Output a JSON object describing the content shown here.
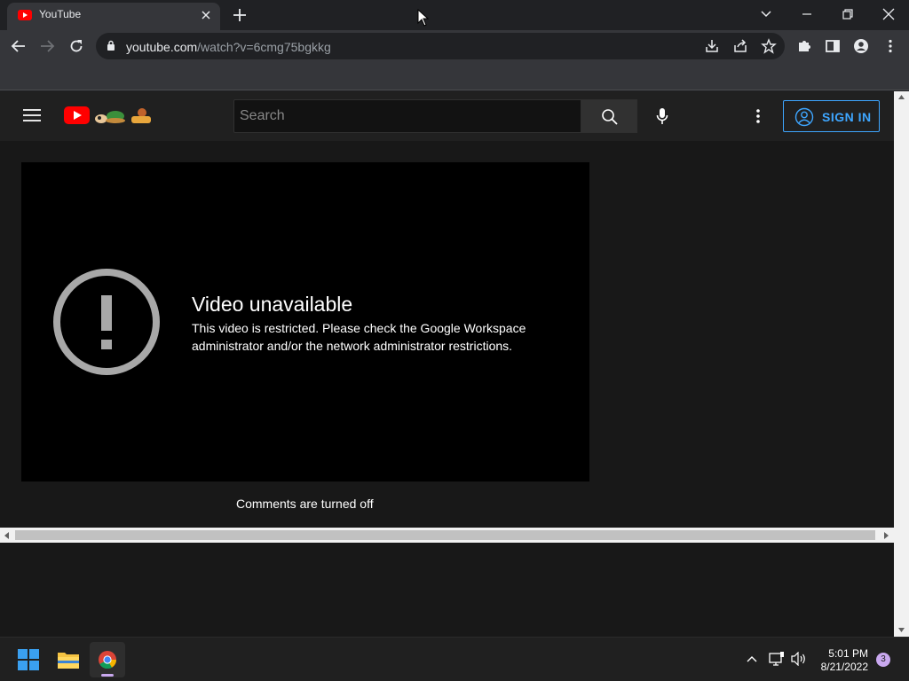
{
  "browser": {
    "tab_title": "YouTube",
    "url_host": "youtube.com",
    "url_path": "/watch?v=6cmg75bgkkg"
  },
  "youtube": {
    "search_placeholder": "Search",
    "signin_label": "SIGN IN",
    "error_title": "Video unavailable",
    "error_message": "This video is restricted. Please check the Google Workspace administrator and/or the network administrator restrictions.",
    "comments_status": "Comments are turned off"
  },
  "taskbar": {
    "time": "5:01 PM",
    "date": "8/21/2022",
    "notification_count": "3"
  },
  "colors": {
    "accent_blue": "#3ea6ff",
    "youtube_red": "#ff0000"
  }
}
